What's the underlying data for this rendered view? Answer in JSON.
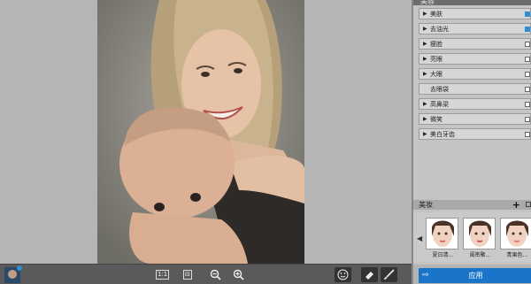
{
  "panel": {
    "header_label": "美容",
    "items": [
      {
        "label": "美肤",
        "expandable": true,
        "checked": true
      },
      {
        "label": "去油光",
        "expandable": true,
        "checked": true
      },
      {
        "label": "瘦脸",
        "expandable": true,
        "checked": false
      },
      {
        "label": "亮眼",
        "expandable": true,
        "checked": false
      },
      {
        "label": "大眼",
        "expandable": true,
        "checked": false
      },
      {
        "label": "去眼袋",
        "expandable": false,
        "checked": false
      },
      {
        "label": "高鼻梁",
        "expandable": true,
        "checked": false
      },
      {
        "label": "微笑",
        "expandable": true,
        "checked": false
      },
      {
        "label": "美白牙齿",
        "expandable": true,
        "checked": false
      }
    ],
    "makeup": {
      "title": "美妆",
      "add_label": "+",
      "thumbnails": [
        {
          "caption": "夏日清…"
        },
        {
          "caption": "闺密聚…"
        },
        {
          "caption": "青果色…"
        }
      ]
    },
    "apply_label": "应用"
  },
  "toolbar": {
    "btn1_label": "1:1",
    "btn2_label": "⊟"
  },
  "colors": {
    "accent": "#1a74c9",
    "checkbox_on": "#2a8fd6"
  }
}
